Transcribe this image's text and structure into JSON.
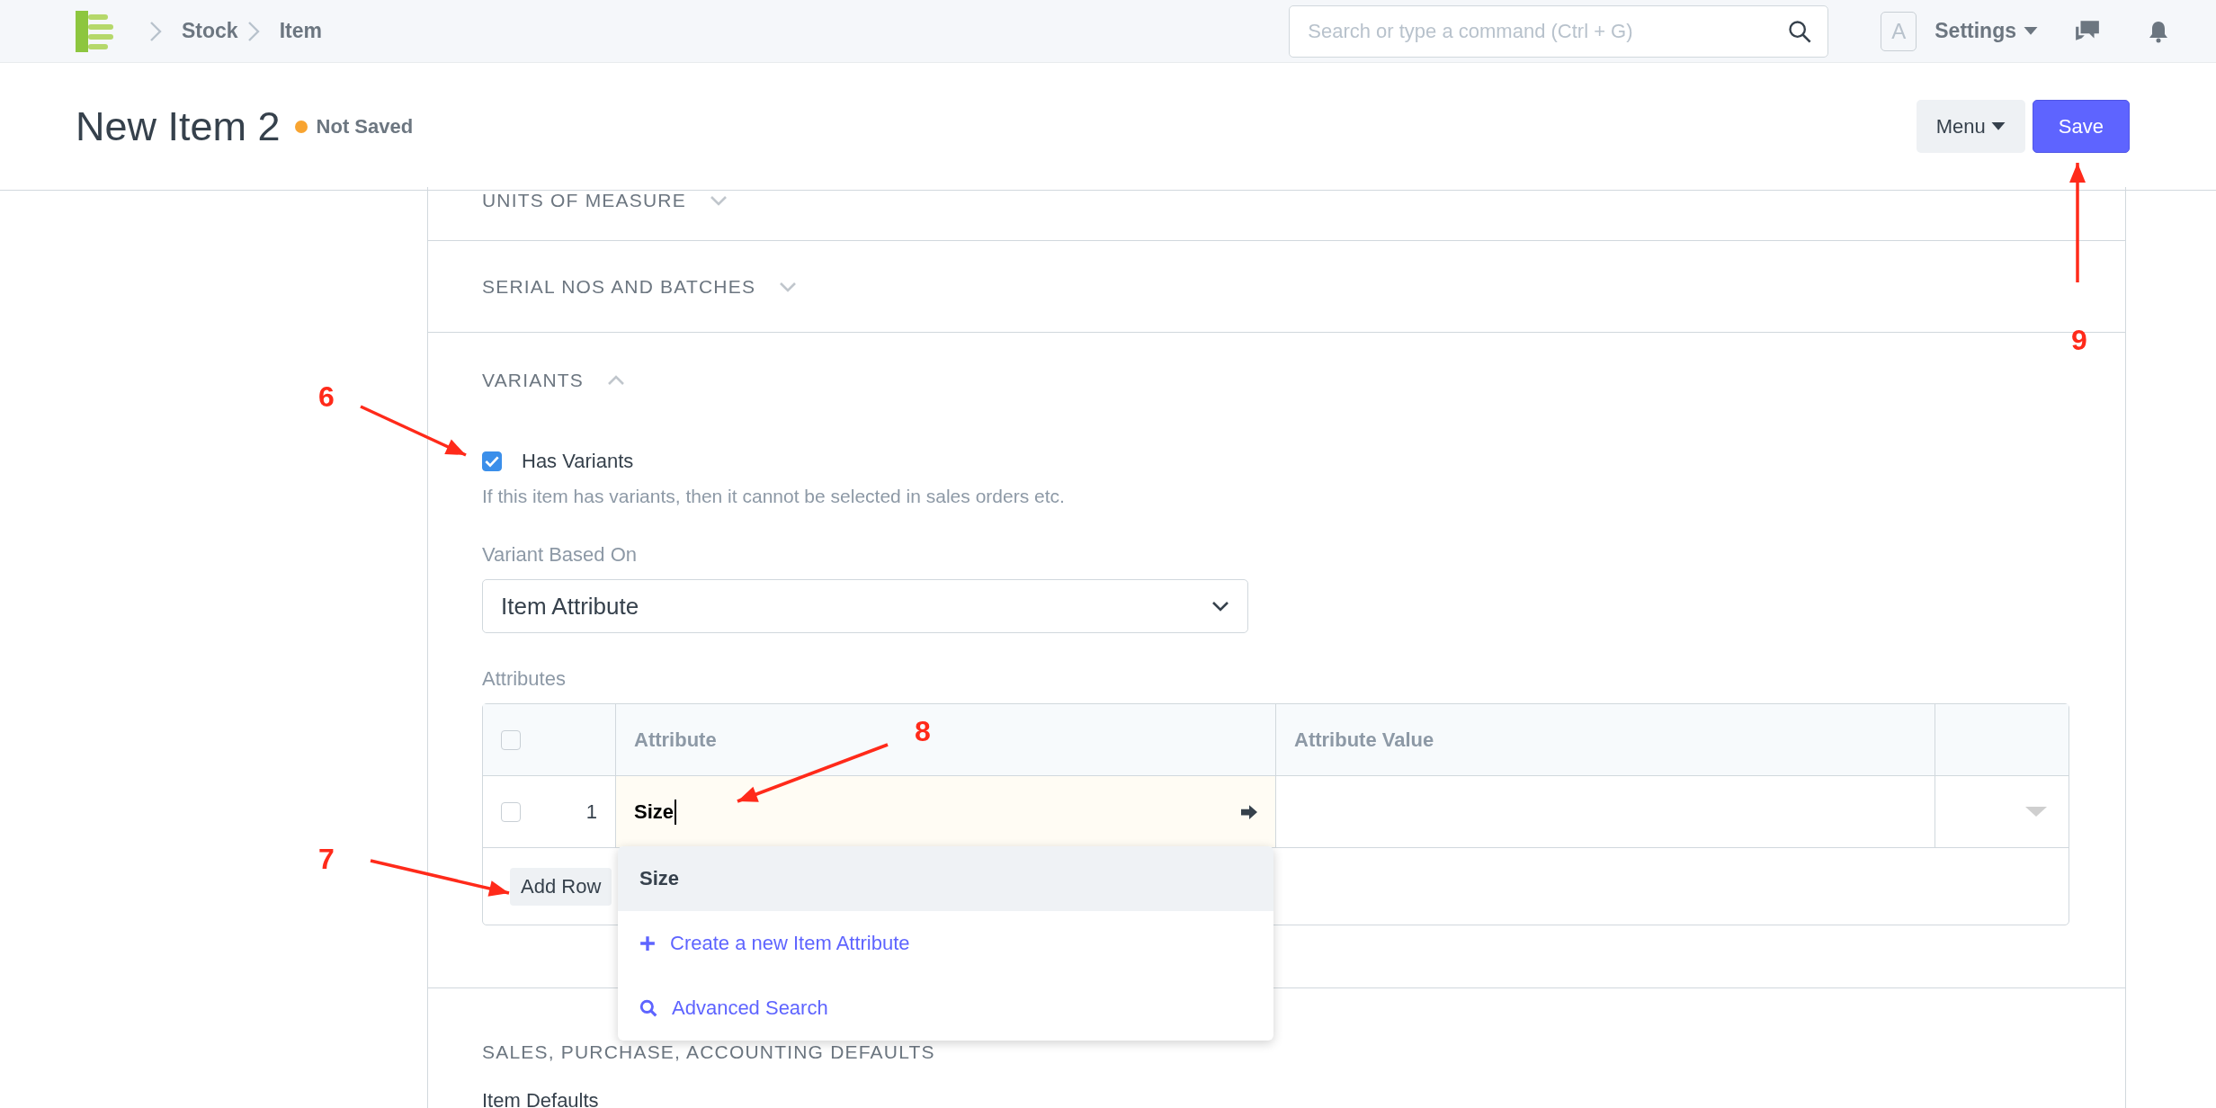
{
  "topbar": {
    "breadcrumbs": [
      {
        "label": "Stock"
      },
      {
        "label": "Item"
      }
    ],
    "search": {
      "placeholder": "Search or type a command (Ctrl + G)"
    },
    "avatar": "A",
    "settings": "Settings"
  },
  "header": {
    "title": "New Item 2",
    "status": "Not Saved",
    "buttons": [
      {
        "label": "Menu",
        "kind": "dropdown"
      },
      {
        "label": "Save",
        "kind": "primary"
      }
    ]
  },
  "sections": [
    {
      "title": "UNITS OF MEASURE",
      "expanded": false
    },
    {
      "title": "SERIAL NOS AND BATCHES",
      "expanded": false
    },
    {
      "title": "VARIANTS",
      "expanded": true
    }
  ],
  "variants": {
    "has_variants": {
      "label": "Has Variants",
      "checked": true,
      "help": "If this item has variants, then it cannot be selected in sales orders etc."
    },
    "variant_based_on": {
      "label": "Variant Based On",
      "value": "Item Attribute"
    },
    "attributes": {
      "label": "Attributes",
      "header_checked": false,
      "columns": [
        "Attribute",
        "Attribute Value"
      ],
      "rows": [
        {
          "index": "1",
          "checked": false,
          "attribute": "Size"
        }
      ],
      "add_row": "Add Row",
      "dropdown": [
        {
          "kind": "match",
          "label": "Size",
          "selected": true
        },
        {
          "kind": "create",
          "label": "Create a new Item Attribute",
          "selected": false
        },
        {
          "kind": "search",
          "label": "Advanced Search",
          "selected": false
        }
      ]
    }
  },
  "lower_section": {
    "title": "SALES, PURCHASE, ACCOUNTING DEFAULTS",
    "field_label": "Item Defaults"
  },
  "annotations": [
    {
      "label": "6"
    },
    {
      "label": "7"
    },
    {
      "label": "8"
    },
    {
      "label": "9"
    }
  ]
}
